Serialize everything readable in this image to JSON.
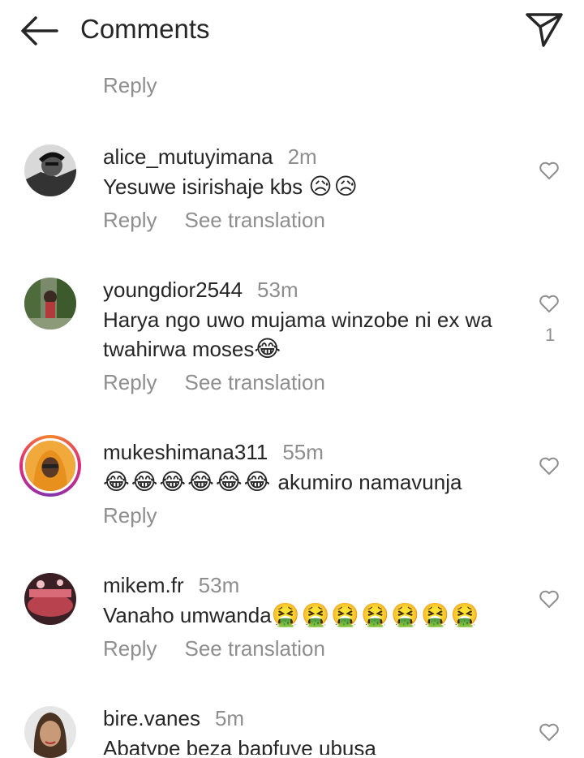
{
  "header": {
    "title": "Comments",
    "back_icon": "arrow-left-icon",
    "share_icon": "paper-plane-icon"
  },
  "top_reply": "Reply",
  "comments": [
    {
      "username": "alice_mutuyimana",
      "time": "2m",
      "text": "Yesuwe isirishaje kbs",
      "emoji": "😥😥",
      "reply": "Reply",
      "translate": "See translation",
      "likes": ""
    },
    {
      "username": "youngdior2544",
      "time": "53m",
      "text": "Harya ngo uwo mujama winzobe ni ex wa twahirwa moses",
      "emoji": "😂",
      "reply": "Reply",
      "translate": "See translation",
      "likes": "1"
    },
    {
      "username": "mukeshimana311",
      "time": "55m",
      "emoji_prefix": "😂😂😂😂😂😂",
      "text": "akumiro namavunja",
      "reply": "Reply",
      "likes": ""
    },
    {
      "username": "mikem.fr",
      "time": "53m",
      "text": "Vanaho umwanda",
      "emoji": "🤮🤮🤮🤮🤮🤮🤮",
      "reply": "Reply",
      "translate": "See translation",
      "likes": ""
    },
    {
      "username": "bire.vanes",
      "time": "5m",
      "text": "Abatype beza bapfuye ubusa",
      "likes": ""
    }
  ],
  "colors": {
    "text": "#262626",
    "muted": "#8e8e8e"
  }
}
